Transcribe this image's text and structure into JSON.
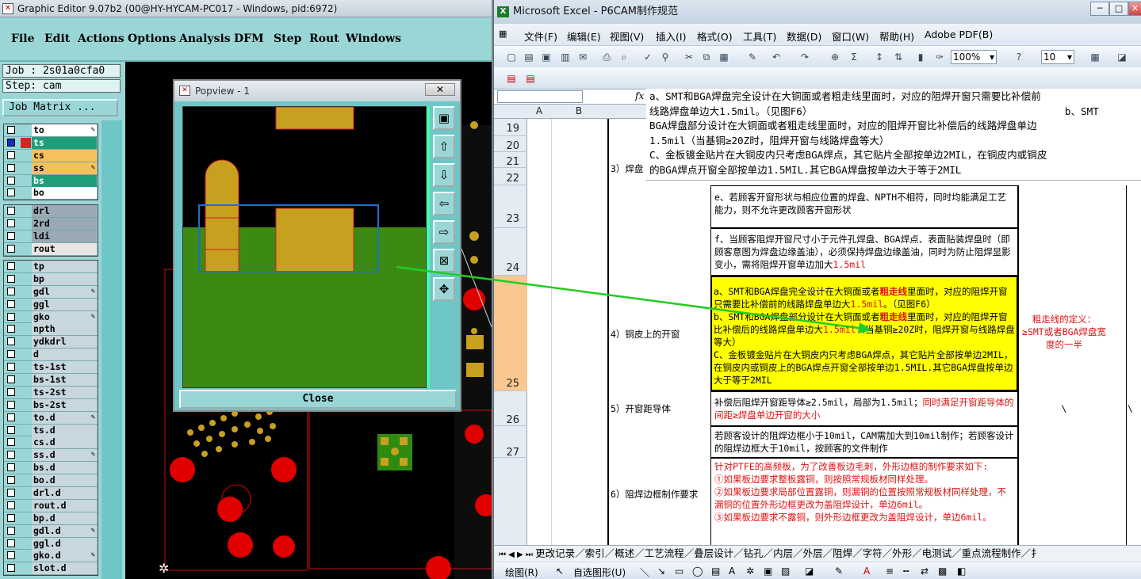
{
  "ge": {
    "title": "Graphic Editor 9.07b2 (00@HY-HYCAM-PC017 - Windows, pid:6972)",
    "menu": [
      "File",
      "Edit",
      "Actions",
      "Options",
      "Analysis",
      "DFM",
      "Step",
      "Rout",
      "Windows"
    ],
    "job": "Job : 2s01a0cfa0",
    "step": "Step: cam",
    "job_matrix": "Job Matrix ...",
    "layers": [
      "to",
      "ts",
      "cs",
      "ss",
      "bs",
      "bo",
      "drl",
      "2rd",
      "ldi",
      "rout",
      "tp",
      "bp",
      "gdl",
      "ggl",
      "gko",
      "npth",
      "ydkdrl",
      "d",
      "ts-1st",
      "bs-1st",
      "ts-2st",
      "bs-2st",
      "to.d",
      "ts.d",
      "cs.d",
      "ss.d",
      "bs.d",
      "bo.d",
      "drl.d",
      "rout.d",
      "bp.d",
      "gdl.d",
      "ggl.d",
      "gko.d",
      "slot.d"
    ],
    "colors": {
      "to": "#ffffff",
      "ts": "#1f9e7a",
      "cs": "#f5c15a",
      "ss": "#f5c15a",
      "bs": "#1f9e7a",
      "bo": "#ffffff",
      "drl": "#9aa9b4",
      "2rd": "#9aa9b4",
      "ldi": "#9aa9b4",
      "rout": "#e6e6e6",
      "other": "#c8d6de"
    }
  },
  "popview": {
    "title": "Popview - 1",
    "close_x": "✕",
    "close_label": "Close"
  },
  "xl": {
    "title": "Microsoft Excel - P6CAM制作规范",
    "menu": [
      "文件(F)",
      "编辑(E)",
      "视图(V)",
      "插入(I)",
      "格式(O)",
      "工具(T)",
      "数据(D)",
      "窗口(W)",
      "帮助(H)",
      "Adobe PDF(B)"
    ],
    "zoom": "100%",
    "font_size": "10",
    "fx": "fx",
    "formula_lines": [
      "a、SMT和BGA焊盘完全设计在大铜面或者粗走线里面时，对应的阻焊开窗只需要比补偿前",
      "线路焊盘单边大1.5mil。（见图F6）                                          b、SMT",
      "BGA焊盘部分设计在大铜面或者粗走线里面时，对应的阻焊开窗比补偿后的线路焊盘单边",
      "1.5mil（当基铜≥20Z时，阻焊开窗与线路焊盘等大）",
      "C、金板镀金贴片在大铜皮内只考虑BGA焊点，其它贴片全部按单边2MIL，在铜皮内或铜皮",
      "的BGA焊点开窗全部按单边1.5MIL.其它BGA焊盘按单边大于等于2MIL"
    ],
    "cols": [
      "A",
      "B"
    ],
    "rows": [
      "19",
      "20",
      "21",
      "22",
      "23",
      "24",
      "25",
      "26",
      "27"
    ],
    "c_label_3": "3）焊盘",
    "r23": "e、若顾客开窗形状与相应位置的焊盘、NPTH不相符，同时均能满足工艺能力，则不允许更改顾客开窗形状",
    "r24a": "f、当顾客阻焊开窗尺寸小于元件孔焊盘、BGA焊点、表面贴装焊盘时（即顾客意图为焊盘边缘盖油），必须保持焊盘边缘盖油，同时为防止阻焊显影变小，需将阻焊开窗单边加大",
    "r24b": "1.5mil",
    "r25_label": "4）铜皮上的开窗",
    "r25_p1": "a、SMT和BGA焊盘完全设计在大铜面或者",
    "r25_bold1": "粗走线",
    "r25_p2": "里面时，对应的阻焊开窗只需要比补偿前的线路焊盘单边大",
    "r25_red1": "1.5mil",
    "r25_p3": "。（见图F6）",
    "r25_p4": "b、SMT和BGA焊盘部分设计在大铜面或者",
    "r25_bold2": "粗走线",
    "r25_p5": "里面时，对应的阻焊开窗比补偿后的线路焊盘单边大",
    "r25_red2": "1.5mil",
    "r25_p6": "（当基铜≥20Z时，阻焊开窗与线路焊盘等大）",
    "r25_p7": "C、金板镀金贴片在大铜皮内只考虑BGA焊点，其它贴片全部按单边2MIL，在铜皮内或铜皮上的BGA焊点开窗全部按单边1.5MIL.其它BGA焊盘按单边大于等于2MIL",
    "r25_note": "粗走线的定义：≥SMT或者BGA焊盘宽度的一半",
    "r26_label": "5）开窗距导体",
    "r26_p1": "补偿后阻焊开窗距导体≥2.5mil，局部为1.5mil；",
    "r26_red": "同时满足开窗距导体的间距≥焊盘单边开窗的大小",
    "r26_c": "\\",
    "r26_d": "\\",
    "r27": "若顾客设计的阻焊边框小于10mil，CAM需加大到10mil制作；若顾客设计的阻焊边框大于10mil，按顾客的文件制作",
    "r28_label": "6）阻焊边框制作要求",
    "r28_lines": [
      "针对PTFE的高频板，为了改善板边毛刺，外形边框的制作要求如下:",
      "①如果板边要求整板露铜，则按照常规板材同样处理。",
      "②如果板边要求局部位置露铜，则漏铜的位置按照常规板材同样处理，不漏铜的位置外形边框更改为盖阻焊设计，单边6mil。",
      "③如果板边要求不露铜，则外形边框更改为盖阻焊设计，单边6mil。"
    ],
    "sheet_tabs": "更改记录／索引／概述／工艺流程／叠层设计／钻孔／内层／外层／阻焊／字符／外形／电测试／重点流程制作／扌",
    "draw": "绘图(R)",
    "autoshape": "自选图形(U)"
  }
}
